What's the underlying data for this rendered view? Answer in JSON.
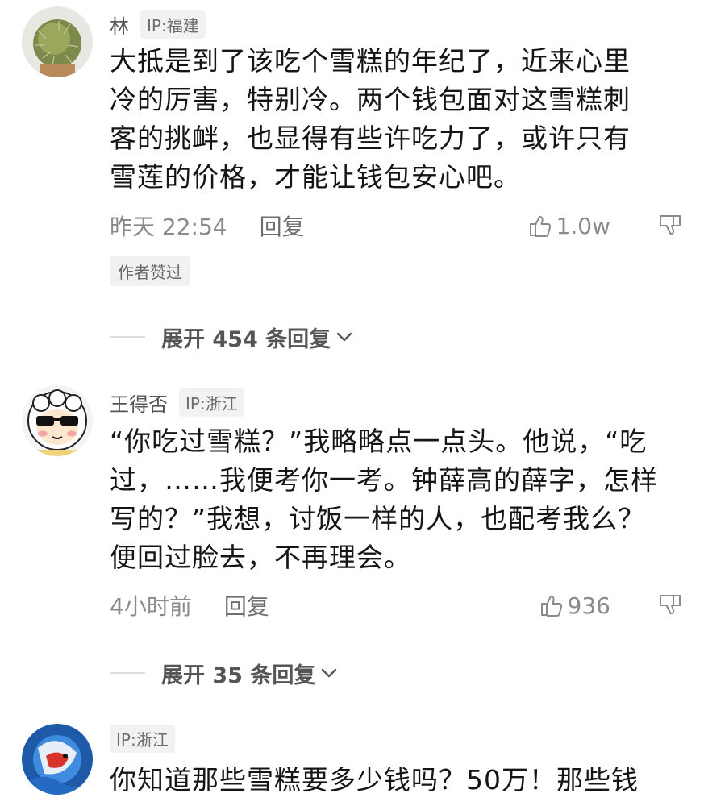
{
  "comments": [
    {
      "username": "林",
      "ip": "IP:福建",
      "lines": [
        "大抵是到了该吃个雪糕的年纪了，近来心里",
        "冷的厉害，特别冷。两个钱包面对这雪糕刺",
        "客的挑衅，也显得有些许吃力了，或许只有",
        "雪莲的价格，才能让钱包安心吧。"
      ],
      "time": "昨天 22:54",
      "reply_label": "回复",
      "likes": "1.0w",
      "author_badge": "作者赞过",
      "expand_label": "展开 454 条回复"
    },
    {
      "username": "王得否",
      "ip": "IP:浙江",
      "lines": [
        "“你吃过雪糕？”我略略点一点头。他说，“吃",
        "过，……我便考你一考。钟薛高的薛字，怎样",
        "写的？”我想，讨饭一样的人，也配考我么？",
        "便回过脸去，不再理会。"
      ],
      "time": "4小时前",
      "reply_label": "回复",
      "likes": "936",
      "expand_label": "展开 35 条回复"
    },
    {
      "username": "",
      "ip": "IP:浙江",
      "lines": [
        "你知道那些雪糕要多少钱吗？50万！那些钱"
      ]
    }
  ],
  "icons": {
    "like": "thumbs-up-icon",
    "dislike": "thumbs-down-icon",
    "expand": "chevron-down-icon"
  },
  "colors": {
    "text": "#151515",
    "secondary": "#8a8a8a",
    "badge_bg": "#f2f2f2"
  }
}
